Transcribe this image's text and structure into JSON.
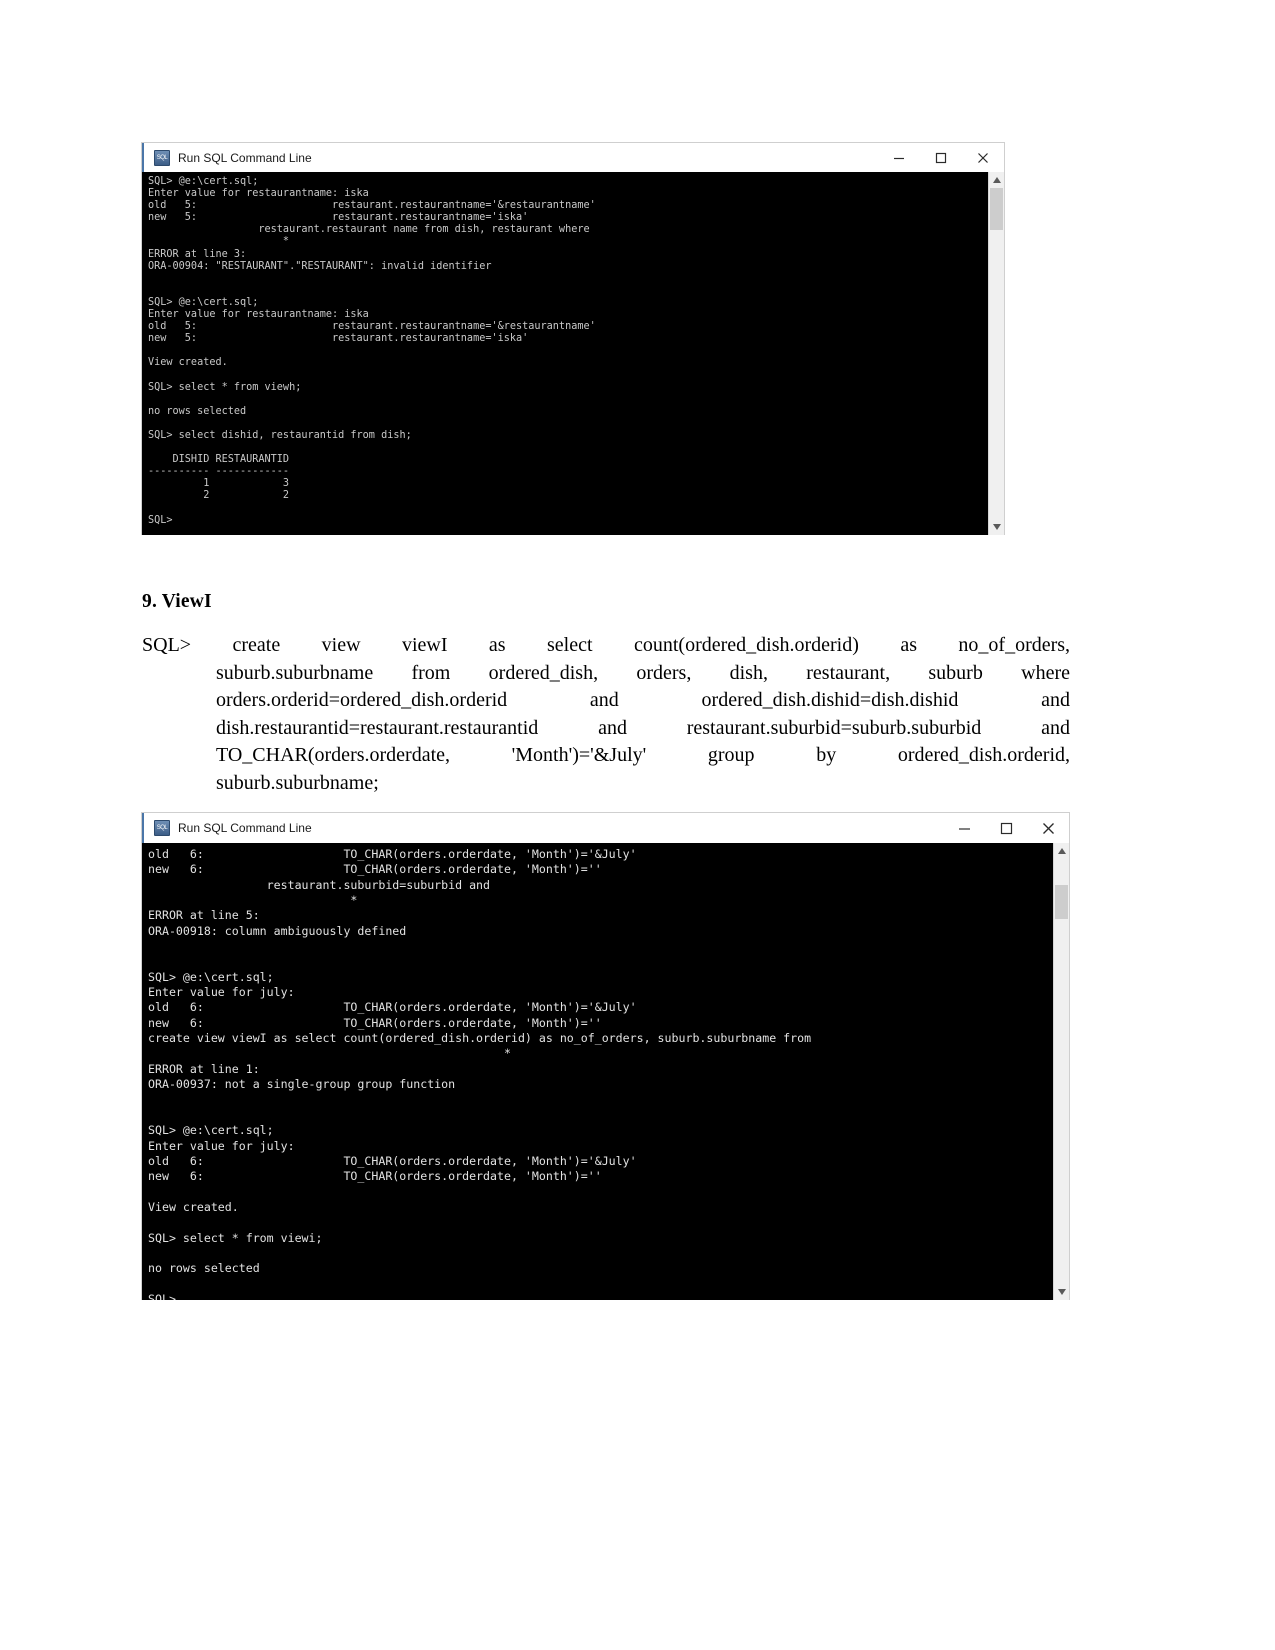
{
  "document": {
    "heading": "9. ViewI",
    "sql_paragraph": {
      "prompt": "SQL>",
      "lines": [
        [
          "create",
          "view",
          "viewI",
          "as",
          "select",
          "count(ordered_dish.orderid)",
          "as",
          "no_of_orders,"
        ],
        [
          "suburb.suburbname",
          "from",
          "ordered_dish,",
          "orders,",
          "dish,",
          "restaurant,",
          "suburb",
          "where"
        ],
        [
          "orders.orderid=ordered_dish.orderid",
          "and",
          "ordered_dish.dishid=dish.dishid",
          "and"
        ],
        [
          "dish.restaurantid=restaurant.restaurantid",
          "and",
          "restaurant.suburbid=suburb.suburbid",
          "and"
        ],
        [
          "TO_CHAR(orders.orderdate,",
          "'Month')='&July'",
          "group",
          "by",
          "ordered_dish.orderid,"
        ],
        [
          "suburb.suburbname;"
        ]
      ]
    }
  },
  "window_top": {
    "title": "Run SQL Command Line",
    "icon": "sql-console-icon",
    "controls": {
      "minimize": "minimize-icon",
      "maximize": "maximize-icon",
      "close": "close-icon"
    },
    "console_output": "SQL> @e:\\cert.sql;\nEnter value for restaurantname: iska\nold   5:                      restaurant.restaurantname='&restaurantname'\nnew   5:                      restaurant.restaurantname='iska'\n                  restaurant.restaurant name from dish, restaurant where\n                      *\nERROR at line 3:\nORA-00904: \"RESTAURANT\".\"RESTAURANT\": invalid identifier\n\n\nSQL> @e:\\cert.sql;\nEnter value for restaurantname: iska\nold   5:                      restaurant.restaurantname='&restaurantname'\nnew   5:                      restaurant.restaurantname='iska'\n\nView created.\n\nSQL> select * from viewh;\n\nno rows selected\n\nSQL> select dishid, restaurantid from dish;\n\n    DISHID RESTAURANTID\n---------- ------------\n         1            3\n         2            2\n\nSQL>",
    "scrollbar": {
      "up_arrow": "scroll-up-icon",
      "down_arrow": "scroll-down-icon"
    }
  },
  "window_bottom": {
    "title": "Run SQL Command Line",
    "icon": "sql-console-icon",
    "controls": {
      "minimize": "minimize-icon",
      "maximize": "maximize-icon",
      "close": "close-icon"
    },
    "console_output": "old   6:                    TO_CHAR(orders.orderdate, 'Month')='&July'\nnew   6:                    TO_CHAR(orders.orderdate, 'Month')=''\n                 restaurant.suburbid=suburbid and\n                             *\nERROR at line 5:\nORA-00918: column ambiguously defined\n\n\nSQL> @e:\\cert.sql;\nEnter value for july:\nold   6:                    TO_CHAR(orders.orderdate, 'Month')='&July'\nnew   6:                    TO_CHAR(orders.orderdate, 'Month')=''\ncreate view viewI as select count(ordered_dish.orderid) as no_of_orders, suburb.suburbname from\n                                                   *\nERROR at line 1:\nORA-00937: not a single-group group function\n\n\nSQL> @e:\\cert.sql;\nEnter value for july:\nold   6:                    TO_CHAR(orders.orderdate, 'Month')='&July'\nnew   6:                    TO_CHAR(orders.orderdate, 'Month')=''\n\nView created.\n\nSQL> select * from viewi;\n\nno rows selected\n\nSQL> ",
    "scrollbar": {
      "up_arrow": "scroll-up-icon",
      "down_arrow": "scroll-down-icon"
    }
  },
  "colors": {
    "console_bg": "#000000",
    "console_fg": "#d6d6d6",
    "titlebar_bg": "#ffffff",
    "accent": "#4a76a8",
    "page_bg": "#ffffff"
  }
}
